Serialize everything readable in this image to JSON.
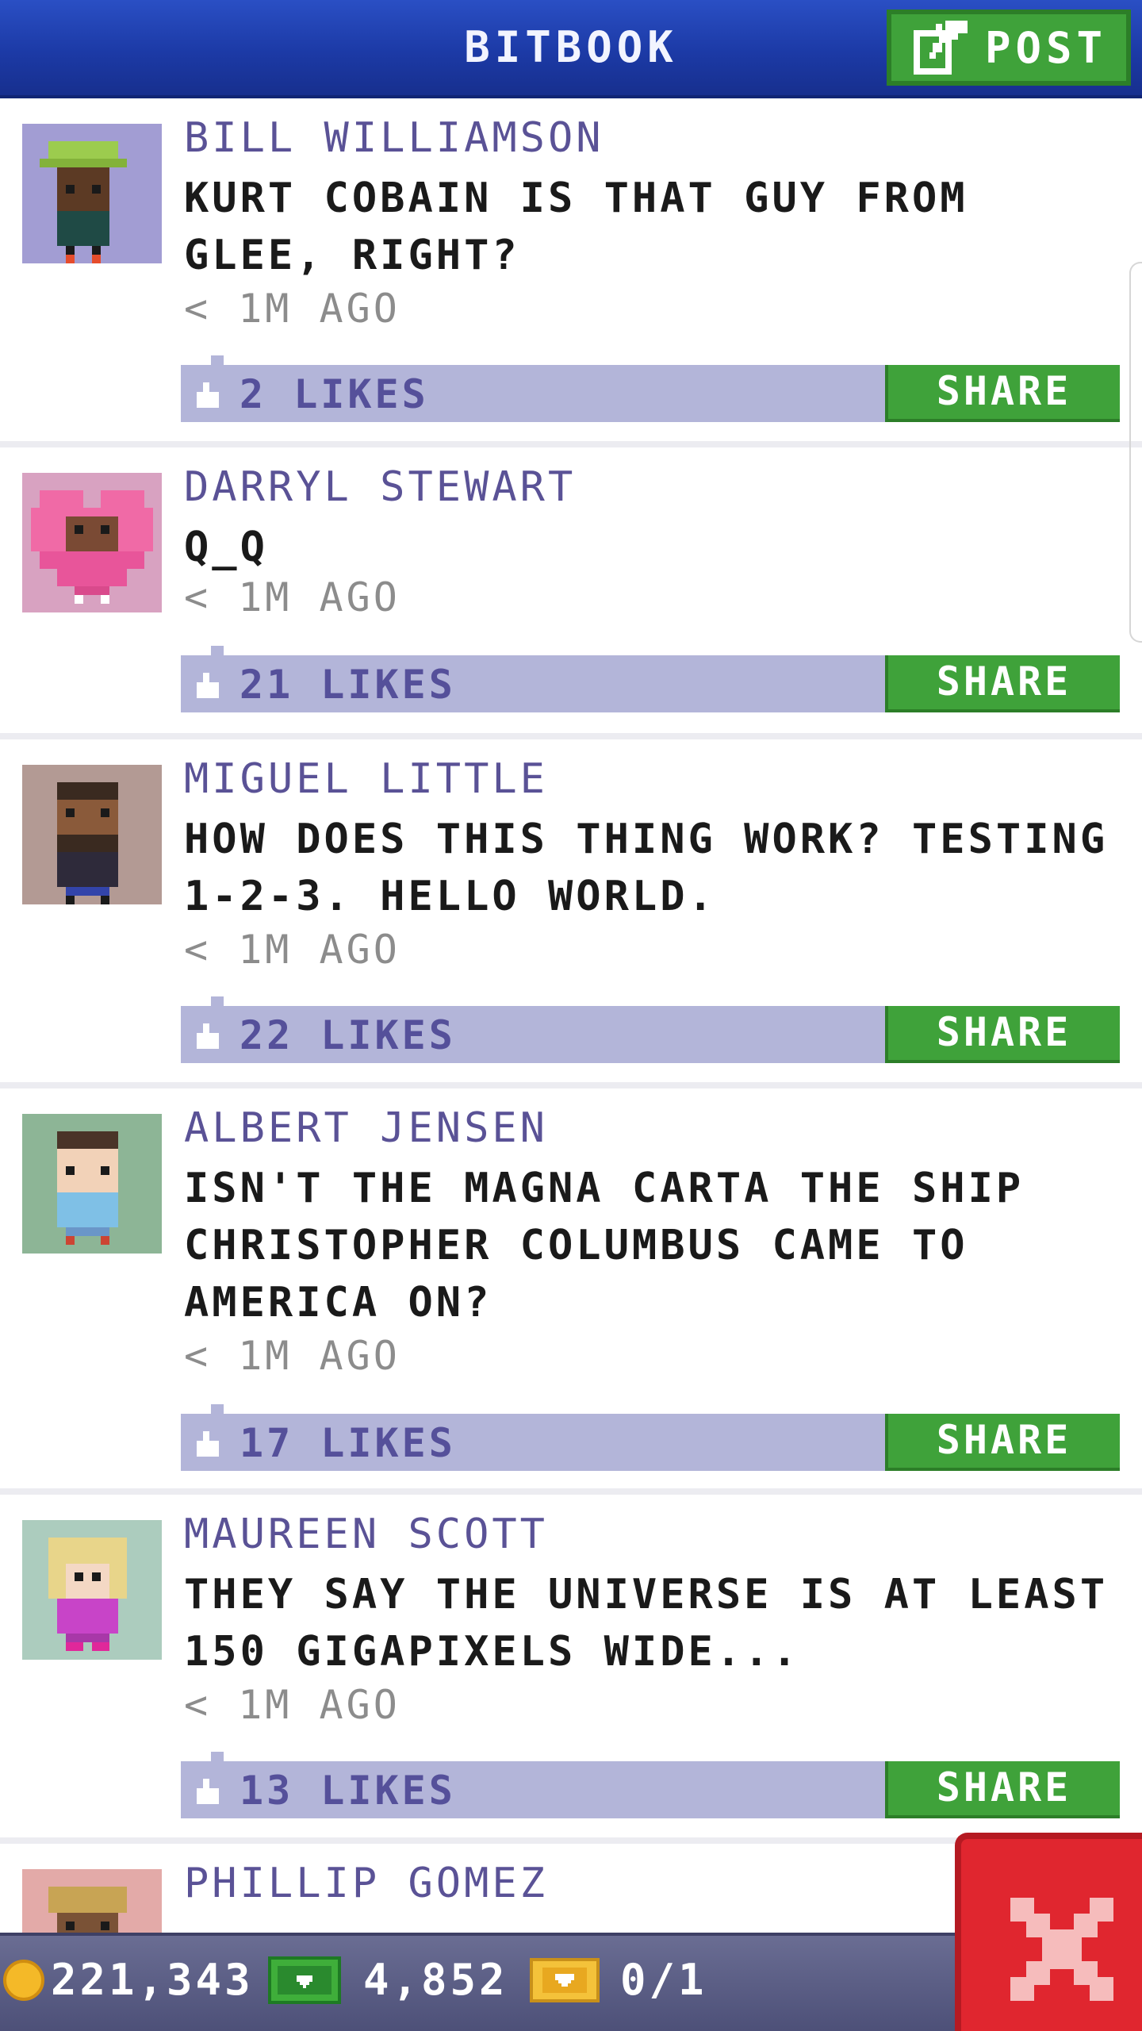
{
  "header": {
    "title": "BITBOOK",
    "post_label": "POST"
  },
  "colors": {
    "header_blue": "#1c3aa6",
    "share_green": "#3fa23a",
    "likes_bar": "#b3b5d9",
    "author_purple": "#5a5296",
    "close_red": "#e0262f"
  },
  "posts": [
    {
      "author": "BILL WILLIAMSON",
      "text": "KURT COBAIN IS THAT GUY FROM GLEE, RIGHT?",
      "time": "< 1M AGO",
      "likes": "2 LIKES",
      "share_label": "SHARE",
      "avatar": "green-cap-man-avatar"
    },
    {
      "author": "DARRYL STEWART",
      "text": "Q_Q",
      "time": "< 1M AGO",
      "likes": "21 LIKES",
      "share_label": "SHARE",
      "avatar": "heart-costume-avatar"
    },
    {
      "author": "MIGUEL LITTLE",
      "text": "HOW DOES THIS THING WORK? TESTING 1-2-3. HELLO WORLD.",
      "time": "< 1M AGO",
      "likes": "22 LIKES",
      "share_label": "SHARE",
      "avatar": "bearded-man-avatar"
    },
    {
      "author": "ALBERT JENSEN",
      "text": "ISN'T THE MAGNA CARTA THE SHIP CHRISTOPHER COLUMBUS CAME TO AMERICA ON?",
      "time": "< 1M AGO",
      "likes": "17 LIKES",
      "share_label": "SHARE",
      "avatar": "blue-shirt-man-avatar"
    },
    {
      "author": "MAUREEN SCOTT",
      "text": "THEY SAY THE UNIVERSE IS AT LEAST 150 GIGAPIXELS WIDE...",
      "time": "< 1M AGO",
      "likes": "13 LIKES",
      "share_label": "SHARE",
      "avatar": "blonde-woman-avatar"
    },
    {
      "author": "PHILLIP GOMEZ",
      "avatar": "hat-man-avatar"
    }
  ],
  "status": {
    "coins": "221,343",
    "bux": "4,852",
    "tickets": "0/1"
  }
}
